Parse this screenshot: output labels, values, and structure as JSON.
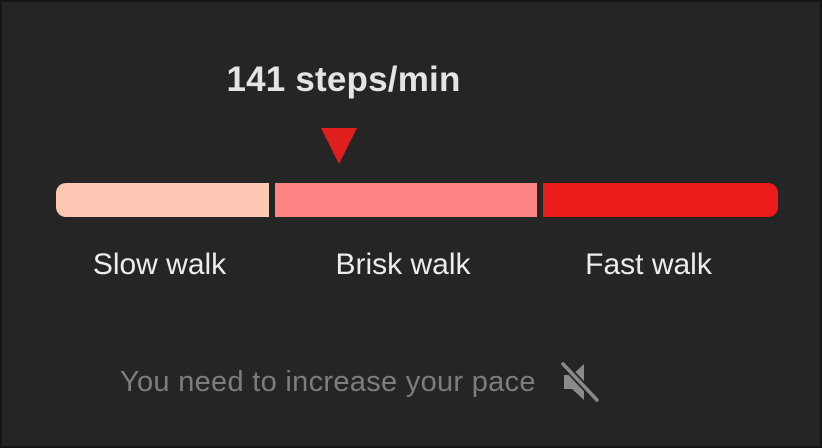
{
  "cadence": {
    "value": 141,
    "unit": "steps/min",
    "readout": "141 steps/min"
  },
  "pace_scale": {
    "pointer_position_fraction": 0.392,
    "zones": [
      {
        "id": "slow",
        "label": "Slow walk",
        "color": "#ffc8b4"
      },
      {
        "id": "brisk",
        "label": "Brisk walk",
        "color": "#ff8585"
      },
      {
        "id": "fast",
        "label": "Fast walk",
        "color": "#ec1c1c"
      }
    ]
  },
  "hint": {
    "text": "You need to increase your pace",
    "sound_icon": "speaker-muted-icon"
  },
  "colors": {
    "background": "#252525",
    "pointer": "#e01e1e",
    "hint_text": "#7d7d7d"
  }
}
